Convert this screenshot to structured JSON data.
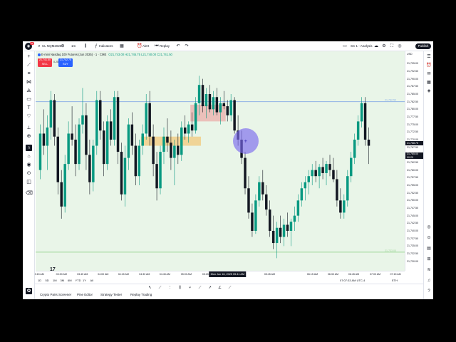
{
  "toolbar": {
    "symbol": "CL NQM2025",
    "timeframe": "1m",
    "indicators": "Indicators",
    "alert": "Alert",
    "replay": "Replay",
    "layout": "SC 1 - Analysis",
    "publish": "Publish",
    "logo_badge": "11"
  },
  "legend": {
    "title": "E-mini Nasdaq 100 Futures (Jun 2025) · 1 · CME",
    "ohlc": "O21,743.00 H21,745.75 L21,740.00 C21,741.50"
  },
  "trade": {
    "sell_price": "21,741.50",
    "sell_label": "SELL",
    "spread": "0.25",
    "buy_price": "21,742.75",
    "buy_label": "BUY"
  },
  "price_axis": {
    "header": "USD",
    "ticks": [
      "21,795.00",
      "21,792.50",
      "21,790.00",
      "21,787.50",
      "21,785.00",
      "21,782.50",
      "21,780.00",
      "21,777.50",
      "21,775.00",
      "21,772.50",
      "21,770.00",
      "21,767.50",
      "21,765.00",
      "21,762.50",
      "21,760.00",
      "21,757.50",
      "21,755.00",
      "21,752.50",
      "21,750.00",
      "21,747.50",
      "21,745.00",
      "21,742.50",
      "21,740.00",
      "21,737.50",
      "21,735.00",
      "21,732.50",
      "21,730.00"
    ],
    "badge_current": "21,768.75",
    "badge_cursor": "21,765.00",
    "badge_cursor_sub": "00:29"
  },
  "time_axis": {
    "ticks": [
      {
        "label": "3:15 AM",
        "x": 0.01
      },
      {
        "label": "03:30 AM",
        "x": 0.07
      },
      {
        "label": "03:45 AM",
        "x": 0.127
      },
      {
        "label": "04:00 AM",
        "x": 0.183
      },
      {
        "label": "04:15 AM",
        "x": 0.238
      },
      {
        "label": "04:30 AM",
        "x": 0.295
      },
      {
        "label": "04:45 AM",
        "x": 0.35
      },
      {
        "label": "05:00 AM",
        "x": 0.408
      },
      {
        "label": "05:15 AM",
        "x": 0.466
      },
      {
        "label": "05:45 AM",
        "x": 0.634
      },
      {
        "label": "06:15 AM",
        "x": 0.75
      },
      {
        "label": "06:30 AM",
        "x": 0.806
      },
      {
        "label": "06:45 AM",
        "x": 0.862
      },
      {
        "label": "07:00 AM",
        "x": 0.92
      },
      {
        "label": "07:15 AM",
        "x": 0.975
      }
    ],
    "cursor_label": "Mon Jun 16, 2025  05:41 AM"
  },
  "range_bar": {
    "ranges": [
      "1D",
      "5D",
      "1M",
      "3M",
      "6M",
      "YTD",
      "1Y",
      "All"
    ],
    "clock": "07:07:33 AM UTC-4",
    "session": "ETH"
  },
  "bottom_tabs": [
    "Crypto Pairs Screener",
    "Pine Editor",
    "Strategy Tester",
    "Replay Trading"
  ],
  "chart_data": {
    "type": "candlestick",
    "ylim": [
      21728.75,
      21796.25
    ],
    "candles": [
      [
        21760,
        21775,
        21757,
        21772
      ],
      [
        21772,
        21780,
        21765,
        21768
      ],
      [
        21768,
        21778,
        21760,
        21774
      ],
      [
        21774,
        21786,
        21770,
        21783
      ],
      [
        21783,
        21785,
        21768,
        21771
      ],
      [
        21771,
        21774,
        21752,
        21756
      ],
      [
        21756,
        21760,
        21744,
        21748
      ],
      [
        21748,
        21765,
        21746,
        21762
      ],
      [
        21762,
        21776,
        21760,
        21772
      ],
      [
        21772,
        21781,
        21768,
        21770
      ],
      [
        21770,
        21775,
        21758,
        21762
      ],
      [
        21762,
        21777,
        21760,
        21775
      ],
      [
        21775,
        21787,
        21772,
        21778
      ],
      [
        21778,
        21782,
        21760,
        21765
      ],
      [
        21765,
        21770,
        21752,
        21756
      ],
      [
        21756,
        21770,
        21753,
        21768
      ],
      [
        21768,
        21786,
        21765,
        21783
      ],
      [
        21783,
        21786,
        21770,
        21773
      ],
      [
        21773,
        21776,
        21758,
        21762
      ],
      [
        21762,
        21778,
        21760,
        21776
      ],
      [
        21776,
        21780,
        21768,
        21770
      ],
      [
        21770,
        21786,
        21768,
        21784
      ],
      [
        21784,
        21786,
        21762,
        21766
      ],
      [
        21766,
        21769,
        21750,
        21752
      ],
      [
        21752,
        21768,
        21748,
        21764
      ],
      [
        21764,
        21777,
        21760,
        21775
      ],
      [
        21775,
        21779,
        21765,
        21768
      ],
      [
        21768,
        21772,
        21755,
        21758
      ],
      [
        21758,
        21770,
        21755,
        21768
      ],
      [
        21768,
        21775,
        21765,
        21772
      ],
      [
        21772,
        21785,
        21770,
        21782
      ],
      [
        21782,
        21786,
        21768,
        21771
      ],
      [
        21771,
        21775,
        21758,
        21762
      ],
      [
        21762,
        21766,
        21750,
        21754
      ],
      [
        21754,
        21768,
        21752,
        21766
      ],
      [
        21766,
        21774,
        21762,
        21771
      ],
      [
        21771,
        21777,
        21766,
        21769
      ],
      [
        21769,
        21773,
        21760,
        21764
      ],
      [
        21764,
        21770,
        21755,
        21768
      ],
      [
        21768,
        21772,
        21762,
        21765
      ],
      [
        21765,
        21776,
        21763,
        21774
      ],
      [
        21774,
        21778,
        21770,
        21772
      ],
      [
        21772,
        21776,
        21769,
        21775
      ],
      [
        21775,
        21779,
        21771,
        21773
      ],
      [
        21773,
        21784,
        21772,
        21782
      ],
      [
        21782,
        21791,
        21778,
        21788
      ],
      [
        21788,
        21790,
        21779,
        21781
      ],
      [
        21781,
        21787,
        21777,
        21785
      ],
      [
        21785,
        21788,
        21779,
        21780
      ],
      [
        21780,
        21786,
        21778,
        21784
      ],
      [
        21784,
        21787,
        21778,
        21779
      ],
      [
        21779,
        21784,
        21775,
        21782
      ],
      [
        21782,
        21786,
        21780,
        21781
      ],
      [
        21781,
        21783,
        21776,
        21778
      ],
      [
        21778,
        21785,
        21776,
        21783
      ],
      [
        21783,
        21784,
        21772,
        21773
      ],
      [
        21773,
        21778,
        21768,
        21770
      ],
      [
        21770,
        21773,
        21762,
        21764
      ],
      [
        21764,
        21766,
        21752,
        21754
      ],
      [
        21754,
        21758,
        21744,
        21746
      ],
      [
        21746,
        21749,
        21738,
        21740
      ],
      [
        21740,
        21752,
        21739,
        21750
      ],
      [
        21750,
        21758,
        21748,
        21756
      ],
      [
        21756,
        21760,
        21750,
        21752
      ],
      [
        21752,
        21755,
        21745,
        21747
      ],
      [
        21747,
        21750,
        21738,
        21740
      ],
      [
        21740,
        21745,
        21734,
        21736
      ],
      [
        21736,
        21743,
        21731,
        21741
      ],
      [
        21741,
        21745,
        21736,
        21738
      ],
      [
        21738,
        21744,
        21735,
        21742
      ],
      [
        21742,
        21746,
        21738,
        21740
      ],
      [
        21740,
        21744,
        21735,
        21743
      ],
      [
        21743,
        21748,
        21740,
        21745
      ],
      [
        21745,
        21752,
        21743,
        21750
      ],
      [
        21750,
        21756,
        21748,
        21754
      ],
      [
        21754,
        21758,
        21750,
        21756
      ],
      [
        21756,
        21760,
        21752,
        21758
      ],
      [
        21758,
        21762,
        21755,
        21760
      ],
      [
        21760,
        21763,
        21756,
        21758
      ],
      [
        21758,
        21762,
        21754,
        21761
      ],
      [
        21761,
        21764,
        21757,
        21759
      ],
      [
        21759,
        21763,
        21755,
        21762
      ],
      [
        21762,
        21765,
        21758,
        21760
      ],
      [
        21760,
        21764,
        21756,
        21757
      ],
      [
        21757,
        21760,
        21748,
        21750
      ],
      [
        21750,
        21754,
        21744,
        21746
      ],
      [
        21746,
        21752,
        21744,
        21750
      ],
      [
        21750,
        21760,
        21748,
        21758
      ],
      [
        21758,
        21766,
        21756,
        21764
      ],
      [
        21764,
        21772,
        21762,
        21770
      ],
      [
        21770,
        21778,
        21768,
        21776
      ],
      [
        21776,
        21784,
        21774,
        21782
      ],
      [
        21782,
        21784,
        21768,
        21770
      ],
      [
        21770,
        21774,
        21762,
        21768
      ]
    ],
    "hlines": [
      {
        "price": 21782.5,
        "color": "#90b4e6",
        "label": "21,782.50"
      },
      {
        "price": 21733.0,
        "color": "#9fd69a",
        "label": "21,733.00"
      }
    ],
    "zones": [
      {
        "from_index": 43,
        "to_index": 53,
        "top": 21781.5,
        "bottom": 21776.0,
        "color": "rgba(242,54,69,0.28)"
      },
      {
        "from_index": 29,
        "to_index": 46,
        "top": 21771.0,
        "bottom": 21768.0,
        "color": "rgba(255,152,0,0.35)"
      }
    ],
    "up_color": "#089981",
    "down_color": "#131722"
  },
  "cursor": {
    "label": "+"
  }
}
